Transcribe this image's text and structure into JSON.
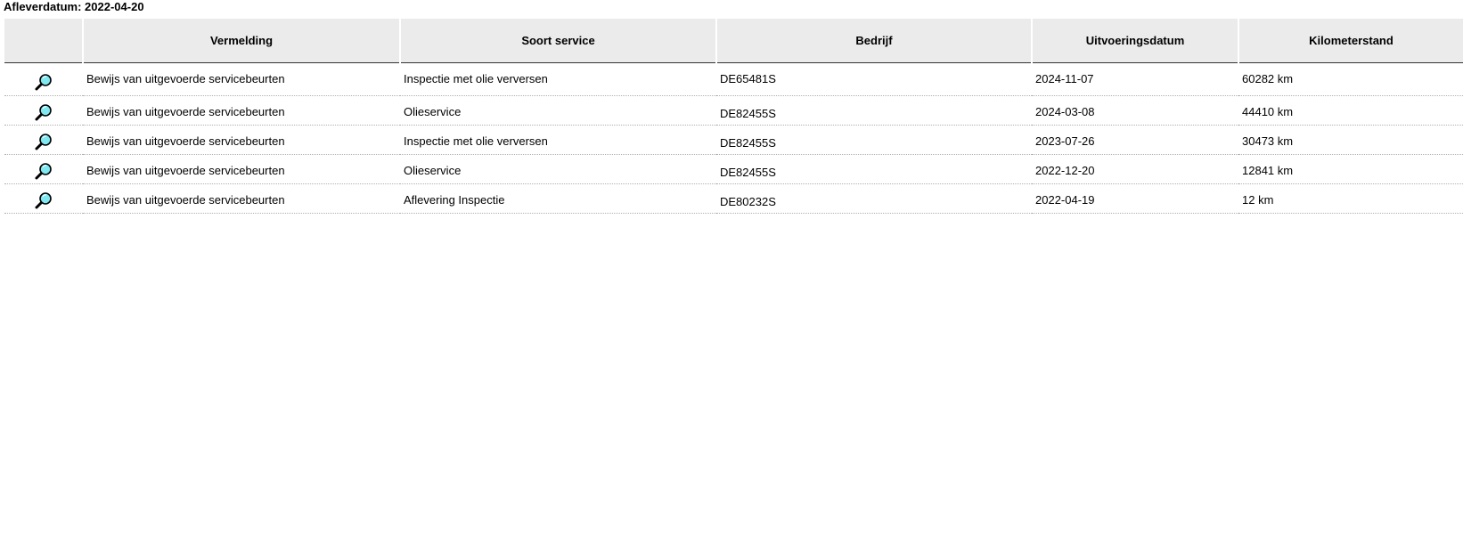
{
  "header": {
    "delivery_label": "Afleverdatum:",
    "delivery_date": "2022-04-20"
  },
  "table": {
    "columns": {
      "icon": "",
      "vermelding": "Vermelding",
      "soort": "Soort service",
      "bedrijf": "Bedrijf",
      "datum": "Uitvoeringsdatum",
      "km": "Kilometerstand"
    },
    "rows": [
      {
        "icon": "magnifier-icon",
        "vermelding": "Bewijs van uitgevoerde servicebeurten",
        "soort": "Inspectie met olie verversen",
        "bedrijf": "DE65481S",
        "datum": "2024-11-07",
        "km": "60282 km"
      },
      {
        "icon": "magnifier-icon",
        "vermelding": "Bewijs van uitgevoerde servicebeurten",
        "soort": "Olieservice",
        "bedrijf": "DE82455S",
        "datum": "2024-03-08",
        "km": "44410 km"
      },
      {
        "icon": "magnifier-icon",
        "vermelding": "Bewijs van uitgevoerde servicebeurten",
        "soort": "Inspectie met olie verversen",
        "bedrijf": "DE82455S",
        "datum": "2023-07-26",
        "km": "30473 km"
      },
      {
        "icon": "magnifier-icon",
        "vermelding": "Bewijs van uitgevoerde servicebeurten",
        "soort": "Olieservice",
        "bedrijf": "DE82455S",
        "datum": "2022-12-20",
        "km": "12841 km"
      },
      {
        "icon": "magnifier-icon",
        "vermelding": "Bewijs van uitgevoerde servicebeurten",
        "soort": "Aflevering Inspectie",
        "bedrijf": "DE80232S",
        "datum": "2022-04-19",
        "km": "12 km"
      }
    ]
  },
  "colors": {
    "header_bg": "#ebebeb",
    "row_divider": "#b0b0b0",
    "lens_fill": "#7fe8f0"
  }
}
